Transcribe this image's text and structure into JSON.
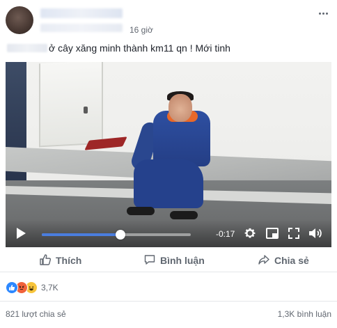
{
  "post": {
    "time_ago": "16 giờ",
    "caption_prefix": "ở",
    "caption_text": "ở cây xăng minh thành km11 qn ! Mới tinh"
  },
  "video": {
    "time_remaining": "-0:17",
    "progress": 0.53
  },
  "actions": {
    "like": "Thích",
    "comment": "Bình luận",
    "share": "Chia sẻ"
  },
  "summary": {
    "reaction_count": "3,7K",
    "reaction_icons": [
      "like-icon",
      "angry-icon",
      "haha-icon"
    ],
    "shares_text": "821 lượt chia sẻ",
    "comments_text": "1,3K bình luận"
  },
  "colors": {
    "like_blue": "#2d88ff",
    "angry_orange": "#f0623b",
    "haha_yellow": "#f7c43b",
    "progress_blue": "#4a7dde"
  }
}
